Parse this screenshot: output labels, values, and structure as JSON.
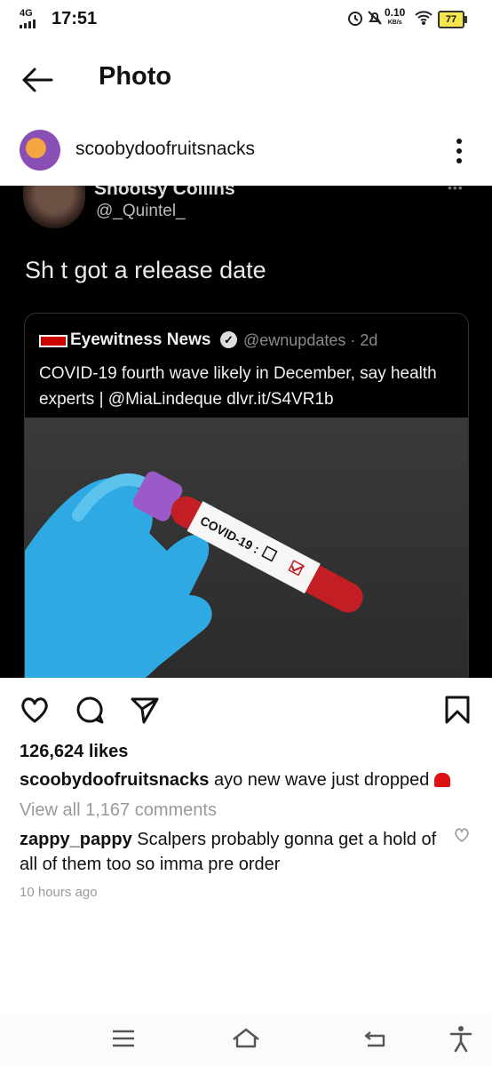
{
  "status_bar": {
    "network": "4G",
    "time": "17:51",
    "speed_value": "0.10",
    "speed_unit": "KB/s",
    "battery": "77"
  },
  "header": {
    "title": "Photo"
  },
  "post": {
    "username": "scoobydoofruitsnacks"
  },
  "tweet": {
    "author_name": "Snootsy Collins",
    "author_handle": "@_Quintel_",
    "text": "Sh t got a release date",
    "quoted": {
      "source": "Eyewitness News",
      "handle_time": "@ewnupdates · 2d",
      "text": "COVID-19 fourth wave likely in December, say health experts | @MiaLindeque dlvr.it/S4VR1b",
      "tube_label": "COVID-19 :"
    }
  },
  "engagement": {
    "likes": "126,624 likes",
    "caption_user": "scoobydoofruitsnacks",
    "caption_text": "ayo new wave just dropped",
    "view_comments": "View all 1,167 comments",
    "comment_user": "zappy_pappy",
    "comment_text": "Scalpers probably gonna get a hold of all of them too so imma pre order",
    "timestamp": "10 hours ago"
  }
}
